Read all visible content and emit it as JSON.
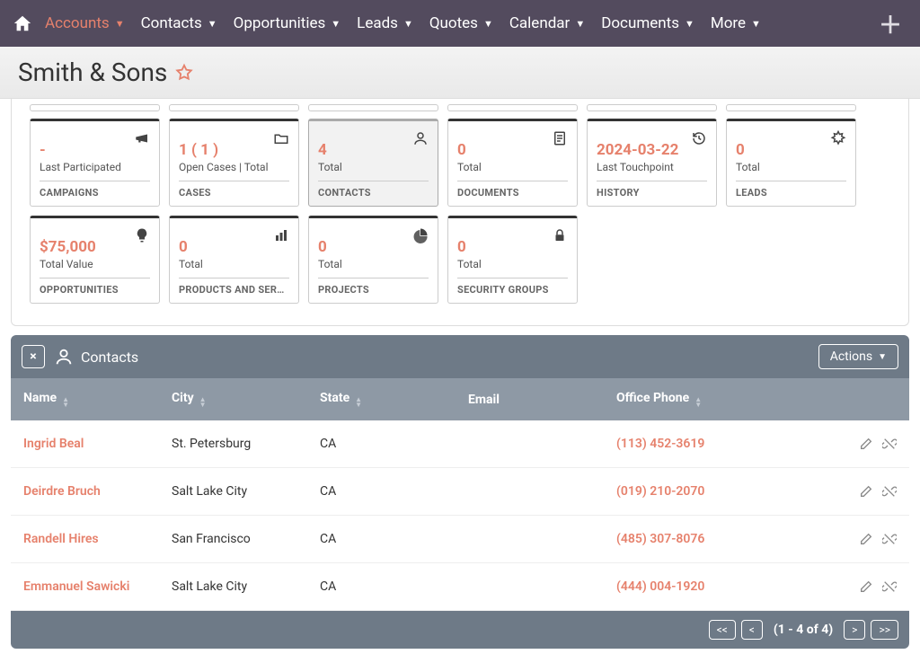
{
  "nav": {
    "items": [
      {
        "label": "Accounts",
        "active": true
      },
      {
        "label": "Contacts",
        "active": false
      },
      {
        "label": "Opportunities",
        "active": false
      },
      {
        "label": "Leads",
        "active": false
      },
      {
        "label": "Quotes",
        "active": false
      },
      {
        "label": "Calendar",
        "active": false
      },
      {
        "label": "Documents",
        "active": false
      },
      {
        "label": "More",
        "active": false
      }
    ]
  },
  "page_title": "Smith & Sons",
  "cards_row1": [
    {
      "value": "-",
      "subtitle": "Last Participated",
      "footer": "CAMPAIGNS",
      "icon": "megaphone",
      "sel": false
    },
    {
      "value": "1 ( 1 )",
      "subtitle": "Open Cases | Total",
      "footer": "CASES",
      "icon": "folder",
      "sel": false
    },
    {
      "value": "4",
      "subtitle": "Total",
      "footer": "CONTACTS",
      "icon": "person",
      "sel": true
    },
    {
      "value": "0",
      "subtitle": "Total",
      "footer": "DOCUMENTS",
      "icon": "document",
      "sel": false
    },
    {
      "value": "2024-03-22",
      "subtitle": "Last Touchpoint",
      "footer": "HISTORY",
      "icon": "history",
      "sel": false
    },
    {
      "value": "0",
      "subtitle": "Total",
      "footer": "LEADS",
      "icon": "star-burst",
      "sel": false
    }
  ],
  "cards_row2": [
    {
      "value": "$75,000",
      "subtitle": "Total Value",
      "footer": "OPPORTUNITIES",
      "icon": "bulb",
      "sel": false
    },
    {
      "value": "0",
      "subtitle": "Total",
      "footer": "PRODUCTS AND SERVI...",
      "icon": "bars",
      "sel": false
    },
    {
      "value": "0",
      "subtitle": "Total",
      "footer": "PROJECTS",
      "icon": "pie",
      "sel": false
    },
    {
      "value": "0",
      "subtitle": "Total",
      "footer": "SECURITY GROUPS",
      "icon": "lock",
      "sel": false
    }
  ],
  "panel": {
    "title": "Contacts",
    "actions_label": "Actions",
    "close_label": "×",
    "columns": [
      "Name",
      "City",
      "State",
      "Email",
      "Office Phone"
    ],
    "rows": [
      {
        "name": "Ingrid Beal",
        "city": "St. Petersburg",
        "state": "CA",
        "email": "",
        "phone": "(113) 452-3619"
      },
      {
        "name": "Deirdre Bruch",
        "city": "Salt Lake City",
        "state": "CA",
        "email": "",
        "phone": "(019) 210-2070"
      },
      {
        "name": "Randell Hires",
        "city": "San Francisco",
        "state": "CA",
        "email": "",
        "phone": "(485) 307-8076"
      },
      {
        "name": "Emmanuel Sawicki",
        "city": "Salt Lake City",
        "state": "CA",
        "email": "",
        "phone": "(444) 004-1920"
      }
    ],
    "pager": {
      "first": "<<",
      "prev": "<",
      "info": "(1 - 4 of 4)",
      "next": ">",
      "last": ">>"
    }
  }
}
